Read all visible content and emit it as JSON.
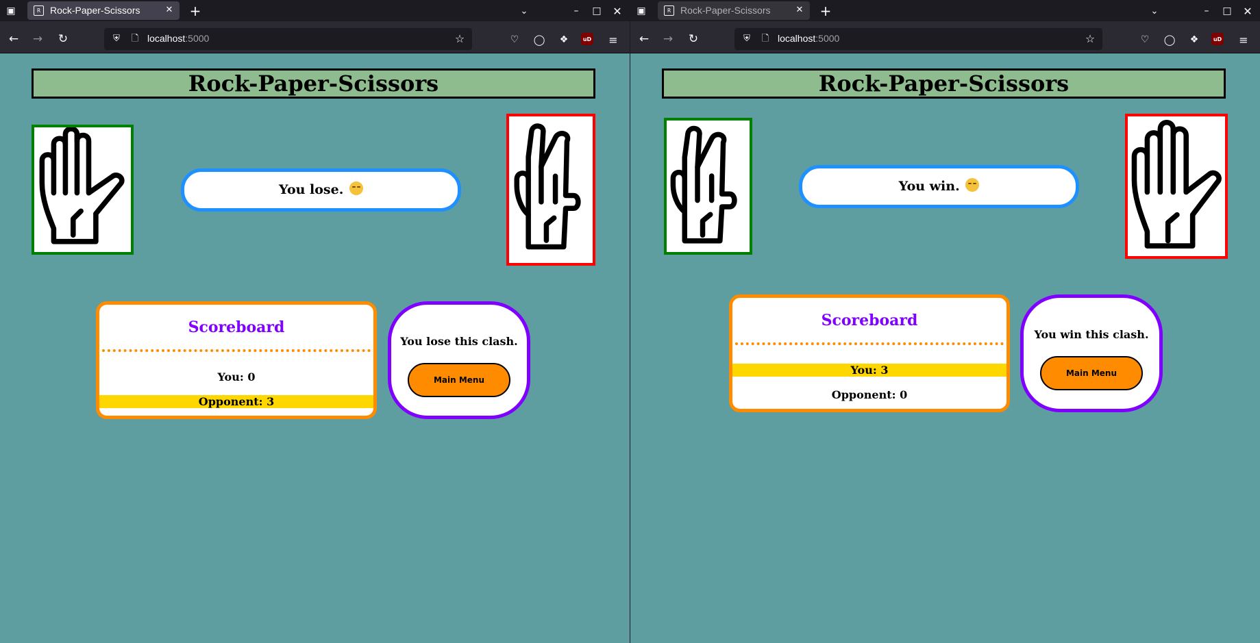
{
  "windows": [
    {
      "tab_title": "Rock-Paper-Scissors",
      "inactive": false,
      "url_host": "localhost",
      "url_port": ":5000",
      "game_title": "Rock-Paper-Scissors",
      "player_hand": "paper",
      "opponent_hand": "scissors",
      "result_text": "You lose.",
      "result_emoji": "relieved-face",
      "scoreboard_title": "Scoreboard",
      "score_you": "You: 0",
      "score_opponent": "Opponent: 3",
      "highlighted_row": "opponent",
      "clash_text": "You lose this clash.",
      "main_menu_label": "Main Menu"
    },
    {
      "tab_title": "Rock-Paper-Scissors",
      "inactive": true,
      "url_host": "localhost",
      "url_port": ":5000",
      "game_title": "Rock-Paper-Scissors",
      "player_hand": "scissors",
      "opponent_hand": "paper",
      "result_text": "You win.",
      "result_emoji": "winking-face",
      "scoreboard_title": "Scoreboard",
      "score_you": "You: 3",
      "score_opponent": "Opponent: 0",
      "highlighted_row": "you",
      "clash_text": "You win this clash.",
      "main_menu_label": "Main Menu"
    }
  ],
  "colors": {
    "page_background": "#5f9ea0",
    "title_background": "#8fbc8f",
    "player_border": "#008000",
    "opponent_border": "#ff0000",
    "result_border": "#1e90ff",
    "scoreboard_border": "#ff8c00",
    "scoreboard_title": "#7f00ff",
    "highlight_row": "#ffd700",
    "clash_border": "#7f00ff",
    "button_background": "#ff8c00"
  }
}
